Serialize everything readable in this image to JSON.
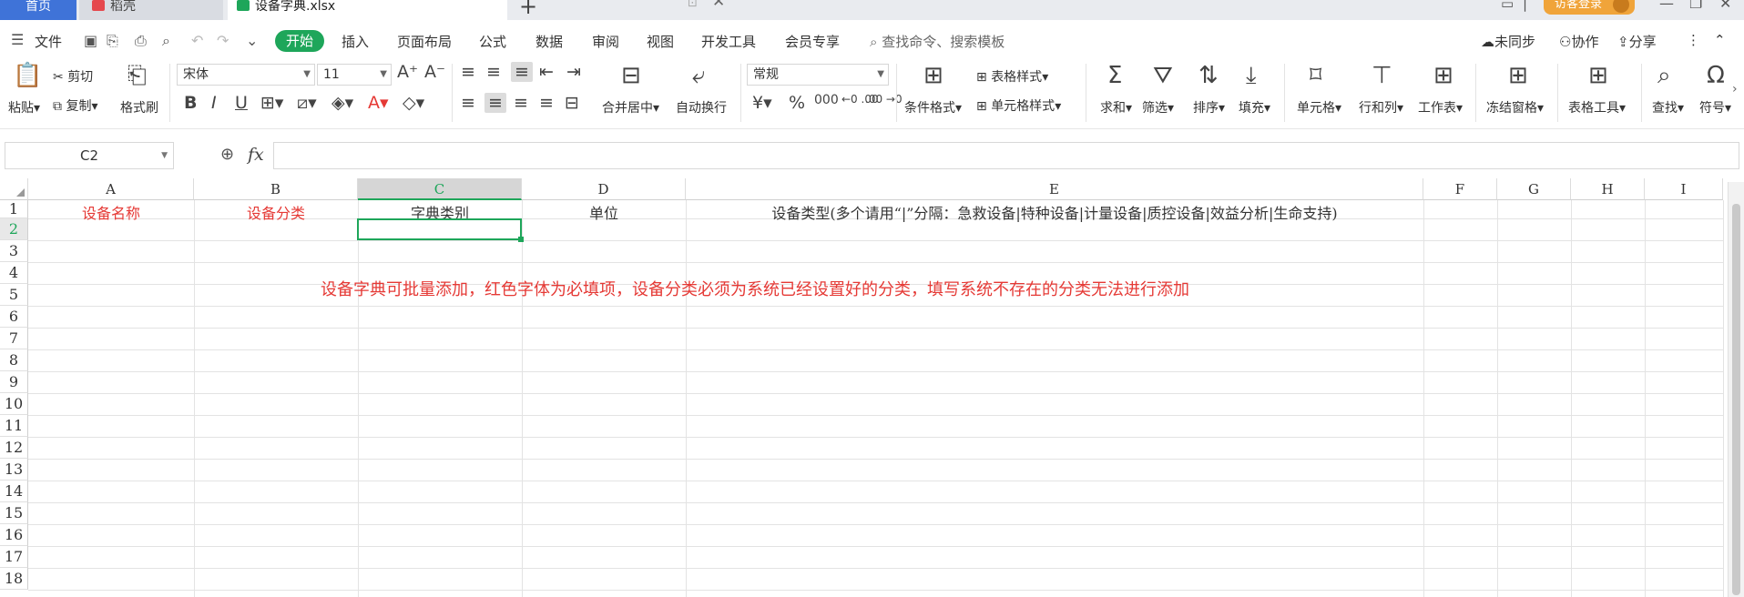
{
  "tabs": {
    "home": "首页",
    "docer": "稻壳",
    "file": "设备字典.xlsx"
  },
  "topbar": {
    "login": "访客登录"
  },
  "menu": {
    "file": "文件",
    "items": [
      "开始",
      "插入",
      "页面布局",
      "公式",
      "数据",
      "审阅",
      "视图",
      "开发工具",
      "会员专享"
    ],
    "search_placeholder": "查找命令、搜索模板",
    "sync": "未同步",
    "collab": "协作",
    "share": "分享"
  },
  "ribbon": {
    "paste": "粘贴",
    "cut": "剪切",
    "copy": "复制",
    "format_painter": "格式刷",
    "font_name": "宋体",
    "font_size": "11",
    "merge_center": "合并居中",
    "wrap_text": "自动换行",
    "number_format": "常规",
    "table_style": "表格样式",
    "conditional_format": "条件格式",
    "cell_style": "单元格样式",
    "sum": "求和",
    "filter": "筛选",
    "sort": "排序",
    "fill": "填充",
    "cell": "单元格",
    "row_col": "行和列",
    "worksheet": "工作表",
    "freeze": "冻结窗格",
    "table_tools": "表格工具",
    "find": "查找",
    "symbol": "符号"
  },
  "formula_bar": {
    "name_box": "C2",
    "fx": "fx",
    "value": ""
  },
  "sheet": {
    "columns": [
      "A",
      "B",
      "C",
      "D",
      "E",
      "F",
      "G",
      "H",
      "I"
    ],
    "rows": [
      "1",
      "2",
      "3",
      "4",
      "5",
      "6",
      "7",
      "8",
      "9",
      "10",
      "11",
      "12",
      "13",
      "14",
      "15",
      "16",
      "17",
      "18"
    ],
    "header_cells": {
      "A1": "设备名称",
      "B1": "设备分类",
      "C1": "字典类别",
      "D1": "单位",
      "E1": "设备类型(多个请用“|”分隔：急救设备|特种设备|计量设备|质控设备|效益分析|生命支持)"
    },
    "note": "设备字典可批量添加，红色字体为必填项，设备分类必须为系统已经设置好的分类，填写系统不存在的分类无法进行添加",
    "selected_cell": "C2",
    "colors": {
      "required": "#e53935",
      "accent": "#1ea65a"
    }
  }
}
